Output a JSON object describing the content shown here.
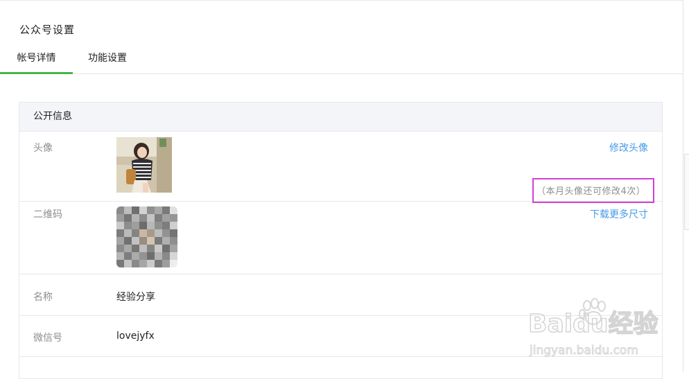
{
  "page": {
    "title": "公众号设置"
  },
  "tabs": [
    {
      "label": "帐号详情",
      "active": true
    },
    {
      "label": "功能设置",
      "active": false
    }
  ],
  "card": {
    "header": "公开信息",
    "rows": {
      "avatar": {
        "label": "头像",
        "link": "修改头像",
        "note": "（本月头像还可修改4次）"
      },
      "qrcode": {
        "label": "二维码",
        "link": "下载更多尺寸"
      },
      "name": {
        "label": "名称",
        "value": "经验分享"
      },
      "wechat_id": {
        "label": "微信号",
        "value": "lovejyfx"
      }
    }
  },
  "watermark": {
    "brand": "Baidu经验",
    "url": "jingyan.baidu.com"
  },
  "colors": {
    "accent_green": "#44b549",
    "link_blue": "#459ae9",
    "highlight_magenta": "#d23fd5"
  }
}
